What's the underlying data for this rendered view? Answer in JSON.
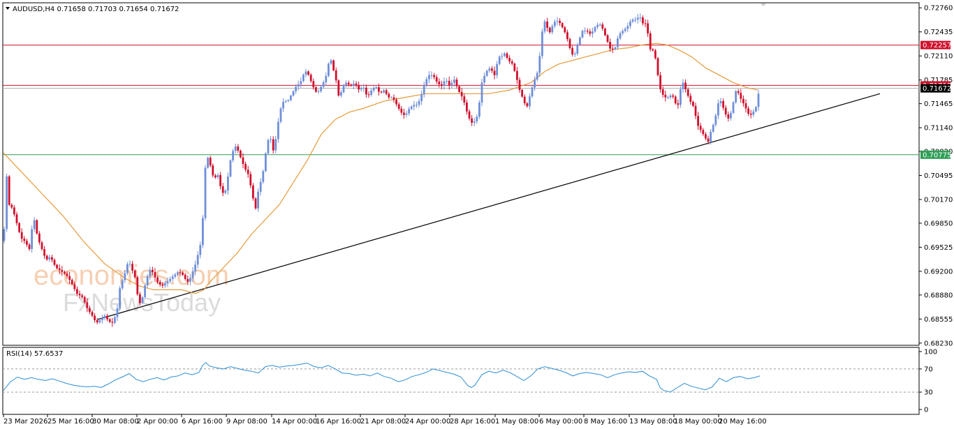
{
  "header": {
    "symbol_line": "AUDUSD,H4  0.71658 0.71703 0.71654 0.71672"
  },
  "rsi_header": "RSI(14) 57.6537",
  "watermark": {
    "line1": "economies.com",
    "line2": "FxNewsToday"
  },
  "colors": {
    "bull": "#6f8fd8",
    "bear": "#d0102c",
    "ma": "#e59a3a",
    "rsi": "#2a8dd4",
    "resistance": "#d0102c",
    "support": "#2e9e57",
    "trend": "#000000",
    "grid": "#808080"
  },
  "levels": [
    {
      "name": "resistance-1",
      "value": 0.72257,
      "label": "0.72257",
      "color": "#d0102c"
    },
    {
      "name": "resistance-2",
      "value": 0.71712,
      "label": "0.71712",
      "color": "#d0102c"
    },
    {
      "name": "current-price",
      "value": 0.71672,
      "label": "0.71672",
      "color": "#000000"
    },
    {
      "name": "support",
      "value": 0.70775,
      "label": "0.70775",
      "color": "#2e9e57"
    }
  ],
  "chart_data": {
    "type": "candlestick",
    "symbol": "AUDUSD",
    "timeframe": "H4",
    "y_ticks": [
      0.7276,
      0.72435,
      0.7211,
      0.71785,
      0.71465,
      0.7114,
      0.7082,
      0.70495,
      0.7017,
      0.6985,
      0.69525,
      0.692,
      0.6888,
      0.68555,
      0.6823
    ],
    "y_tick_labels": [
      "0.72760",
      "0.72435",
      "0.72110",
      "0.71785",
      "0.71465",
      "0.71140",
      "0.70820",
      "0.70495",
      "0.70170",
      "0.69850",
      "0.69525",
      "0.69200",
      "0.68880",
      "0.68555",
      "0.68230"
    ],
    "ylim": [
      0.682,
      0.7295
    ],
    "x_labels": [
      "23 Mar 2026",
      "25 Mar 16:00",
      "30 Mar 08:00",
      "2 Apr 00:00",
      "6 Apr 16:00",
      "9 Apr 08:00",
      "14 Apr 00:00",
      "16 Apr 16:00",
      "21 Apr 08:00",
      "24 Apr 00:00",
      "28 Apr 16:00",
      "1 May 08:00",
      "6 May 00:00",
      "8 May 16:00",
      "13 May 08:00",
      "18 May 00:00",
      "20 May 16:00"
    ],
    "price_path": [
      [
        0,
        0.7015
      ],
      [
        4,
        0.6925
      ],
      [
        9,
        0.7055
      ],
      [
        13,
        0.701
      ],
      [
        18,
        0.7005
      ],
      [
        24,
        0.6985
      ],
      [
        30,
        0.6965
      ],
      [
        36,
        0.696
      ],
      [
        42,
        0.695
      ],
      [
        48,
        0.6995
      ],
      [
        54,
        0.6965
      ],
      [
        60,
        0.695
      ],
      [
        66,
        0.6935
      ],
      [
        72,
        0.694
      ],
      [
        80,
        0.6925
      ],
      [
        88,
        0.692
      ],
      [
        95,
        0.6915
      ],
      [
        102,
        0.6905
      ],
      [
        110,
        0.689
      ],
      [
        118,
        0.6885
      ],
      [
        125,
        0.687
      ],
      [
        132,
        0.686
      ],
      [
        138,
        0.685
      ],
      [
        144,
        0.6855
      ],
      [
        150,
        0.686
      ],
      [
        156,
        0.6852
      ],
      [
        162,
        0.685
      ],
      [
        168,
        0.687
      ],
      [
        172,
        0.69
      ],
      [
        178,
        0.6915
      ],
      [
        184,
        0.6935
      ],
      [
        188,
        0.6925
      ],
      [
        194,
        0.691
      ],
      [
        198,
        0.688
      ],
      [
        202,
        0.6875
      ],
      [
        206,
        0.6895
      ],
      [
        210,
        0.691
      ],
      [
        216,
        0.6925
      ],
      [
        220,
        0.6915
      ],
      [
        226,
        0.6905
      ],
      [
        232,
        0.69
      ],
      [
        238,
        0.6905
      ],
      [
        244,
        0.691
      ],
      [
        250,
        0.6915
      ],
      [
        256,
        0.692
      ],
      [
        262,
        0.6915
      ],
      [
        268,
        0.6905
      ],
      [
        272,
        0.691
      ],
      [
        276,
        0.692
      ],
      [
        280,
        0.693
      ],
      [
        284,
        0.6945
      ],
      [
        288,
        0.696
      ],
      [
        291,
        0.7
      ],
      [
        294,
        0.706
      ],
      [
        298,
        0.7075
      ],
      [
        302,
        0.706
      ],
      [
        306,
        0.7045
      ],
      [
        312,
        0.705
      ],
      [
        318,
        0.7025
      ],
      [
        324,
        0.703
      ],
      [
        328,
        0.706
      ],
      [
        332,
        0.708
      ],
      [
        338,
        0.709
      ],
      [
        344,
        0.7075
      ],
      [
        350,
        0.706
      ],
      [
        356,
        0.705
      ],
      [
        362,
        0.702
      ],
      [
        366,
        0.7005
      ],
      [
        370,
        0.703
      ],
      [
        376,
        0.705
      ],
      [
        382,
        0.709
      ],
      [
        386,
        0.7105
      ],
      [
        392,
        0.708
      ],
      [
        398,
        0.712
      ],
      [
        402,
        0.714
      ],
      [
        406,
        0.715
      ],
      [
        412,
        0.715
      ],
      [
        418,
        0.716
      ],
      [
        424,
        0.717
      ],
      [
        430,
        0.7175
      ],
      [
        434,
        0.7185
      ],
      [
        438,
        0.719
      ],
      [
        442,
        0.7185
      ],
      [
        448,
        0.717
      ],
      [
        454,
        0.716
      ],
      [
        460,
        0.717
      ],
      [
        466,
        0.718
      ],
      [
        470,
        0.72
      ],
      [
        474,
        0.7205
      ],
      [
        478,
        0.719
      ],
      [
        482,
        0.7175
      ],
      [
        486,
        0.715
      ],
      [
        490,
        0.717
      ],
      [
        496,
        0.7175
      ],
      [
        502,
        0.717
      ],
      [
        508,
        0.7175
      ],
      [
        514,
        0.7165
      ],
      [
        520,
        0.717
      ],
      [
        526,
        0.7155
      ],
      [
        532,
        0.7165
      ],
      [
        538,
        0.717
      ],
      [
        544,
        0.716
      ],
      [
        550,
        0.7165
      ],
      [
        556,
        0.7155
      ],
      [
        562,
        0.7155
      ],
      [
        568,
        0.7145
      ],
      [
        574,
        0.7135
      ],
      [
        580,
        0.713
      ],
      [
        586,
        0.714
      ],
      [
        592,
        0.7145
      ],
      [
        598,
        0.7145
      ],
      [
        604,
        0.716
      ],
      [
        608,
        0.7175
      ],
      [
        614,
        0.7185
      ],
      [
        620,
        0.7185
      ],
      [
        626,
        0.7175
      ],
      [
        632,
        0.717
      ],
      [
        638,
        0.718
      ],
      [
        644,
        0.717
      ],
      [
        650,
        0.718
      ],
      [
        656,
        0.7165
      ],
      [
        662,
        0.7155
      ],
      [
        666,
        0.7145
      ],
      [
        670,
        0.713
      ],
      [
        676,
        0.712
      ],
      [
        682,
        0.7125
      ],
      [
        686,
        0.7145
      ],
      [
        690,
        0.7175
      ],
      [
        696,
        0.719
      ],
      [
        702,
        0.7195
      ],
      [
        708,
        0.7185
      ],
      [
        714,
        0.721
      ],
      [
        718,
        0.721
      ],
      [
        722,
        0.7215
      ],
      [
        728,
        0.7205
      ],
      [
        734,
        0.72
      ],
      [
        740,
        0.718
      ],
      [
        744,
        0.7165
      ],
      [
        748,
        0.7155
      ],
      [
        754,
        0.714
      ],
      [
        758,
        0.7155
      ],
      [
        764,
        0.7175
      ],
      [
        770,
        0.719
      ],
      [
        774,
        0.722
      ],
      [
        778,
        0.726
      ],
      [
        782,
        0.7255
      ],
      [
        786,
        0.724
      ],
      [
        790,
        0.725
      ],
      [
        796,
        0.726
      ],
      [
        802,
        0.7255
      ],
      [
        808,
        0.7245
      ],
      [
        812,
        0.7235
      ],
      [
        818,
        0.7215
      ],
      [
        822,
        0.721
      ],
      [
        828,
        0.723
      ],
      [
        834,
        0.7245
      ],
      [
        840,
        0.7245
      ],
      [
        846,
        0.724
      ],
      [
        852,
        0.725
      ],
      [
        858,
        0.7255
      ],
      [
        862,
        0.725
      ],
      [
        868,
        0.7235
      ],
      [
        874,
        0.722
      ],
      [
        880,
        0.722
      ],
      [
        886,
        0.724
      ],
      [
        892,
        0.7245
      ],
      [
        898,
        0.725
      ],
      [
        904,
        0.726
      ],
      [
        910,
        0.726
      ],
      [
        916,
        0.7265
      ],
      [
        920,
        0.7255
      ],
      [
        924,
        0.7255
      ],
      [
        928,
        0.724
      ],
      [
        932,
        0.7215
      ],
      [
        936,
        0.722
      ],
      [
        940,
        0.72
      ],
      [
        944,
        0.717
      ],
      [
        948,
        0.716
      ],
      [
        952,
        0.7155
      ],
      [
        958,
        0.7155
      ],
      [
        962,
        0.716
      ],
      [
        966,
        0.715
      ],
      [
        970,
        0.714
      ],
      [
        974,
        0.7165
      ],
      [
        978,
        0.7175
      ],
      [
        984,
        0.716
      ],
      [
        988,
        0.715
      ],
      [
        992,
        0.7145
      ],
      [
        996,
        0.713
      ],
      [
        1000,
        0.7115
      ],
      [
        1004,
        0.711
      ],
      [
        1010,
        0.71
      ],
      [
        1014,
        0.7095
      ],
      [
        1018,
        0.711
      ],
      [
        1022,
        0.712
      ],
      [
        1026,
        0.7135
      ],
      [
        1030,
        0.7155
      ],
      [
        1036,
        0.714
      ],
      [
        1040,
        0.713
      ],
      [
        1044,
        0.7125
      ],
      [
        1048,
        0.714
      ],
      [
        1054,
        0.7165
      ],
      [
        1058,
        0.716
      ],
      [
        1062,
        0.715
      ],
      [
        1066,
        0.7145
      ],
      [
        1070,
        0.7135
      ],
      [
        1074,
        0.713
      ],
      [
        1078,
        0.7135
      ],
      [
        1082,
        0.714
      ],
      [
        1086,
        0.716
      ],
      [
        1088,
        0.7167
      ]
    ],
    "ma_path": [
      [
        5,
        0.708
      ],
      [
        30,
        0.7055
      ],
      [
        60,
        0.7025
      ],
      [
        90,
        0.6995
      ],
      [
        120,
        0.696
      ],
      [
        150,
        0.693
      ],
      [
        180,
        0.691
      ],
      [
        200,
        0.69
      ],
      [
        220,
        0.6895
      ],
      [
        240,
        0.6895
      ],
      [
        260,
        0.6895
      ],
      [
        280,
        0.689
      ],
      [
        292,
        0.6895
      ],
      [
        300,
        0.6905
      ],
      [
        320,
        0.6925
      ],
      [
        340,
        0.6945
      ],
      [
        360,
        0.697
      ],
      [
        380,
        0.699
      ],
      [
        400,
        0.701
      ],
      [
        420,
        0.704
      ],
      [
        440,
        0.707
      ],
      [
        460,
        0.7105
      ],
      [
        480,
        0.7125
      ],
      [
        500,
        0.7135
      ],
      [
        520,
        0.714
      ],
      [
        550,
        0.715
      ],
      [
        580,
        0.7155
      ],
      [
        610,
        0.716
      ],
      [
        640,
        0.716
      ],
      [
        670,
        0.716
      ],
      [
        700,
        0.716
      ],
      [
        730,
        0.7165
      ],
      [
        760,
        0.7175
      ],
      [
        780,
        0.719
      ],
      [
        800,
        0.72
      ],
      [
        820,
        0.7205
      ],
      [
        840,
        0.721
      ],
      [
        860,
        0.7215
      ],
      [
        880,
        0.722
      ],
      [
        900,
        0.7222
      ],
      [
        920,
        0.7226
      ],
      [
        940,
        0.7228
      ],
      [
        955,
        0.7226
      ],
      [
        970,
        0.722
      ],
      [
        990,
        0.721
      ],
      [
        1010,
        0.7195
      ],
      [
        1030,
        0.7185
      ],
      [
        1050,
        0.7175
      ],
      [
        1070,
        0.7168
      ],
      [
        1085,
        0.7165
      ]
    ],
    "trend_line": [
      [
        140,
        0.6855
      ],
      [
        1260,
        0.716
      ]
    ],
    "rsi": {
      "period": 14,
      "value": 57.6537,
      "levels": [
        70,
        30
      ],
      "y_ticks": [
        100,
        70,
        30,
        0
      ],
      "ylim": [
        0,
        100
      ],
      "path": [
        [
          5,
          33
        ],
        [
          15,
          48
        ],
        [
          25,
          56
        ],
        [
          35,
          52
        ],
        [
          45,
          55
        ],
        [
          55,
          52
        ],
        [
          65,
          50
        ],
        [
          75,
          53
        ],
        [
          85,
          49
        ],
        [
          95,
          45
        ],
        [
          105,
          42
        ],
        [
          115,
          40
        ],
        [
          125,
          39
        ],
        [
          135,
          40
        ],
        [
          145,
          38
        ],
        [
          155,
          44
        ],
        [
          165,
          51
        ],
        [
          175,
          56
        ],
        [
          185,
          62
        ],
        [
          195,
          52
        ],
        [
          205,
          48
        ],
        [
          215,
          52
        ],
        [
          225,
          55
        ],
        [
          235,
          51
        ],
        [
          245,
          56
        ],
        [
          255,
          58
        ],
        [
          265,
          63
        ],
        [
          275,
          60
        ],
        [
          285,
          64
        ],
        [
          290,
          76
        ],
        [
          295,
          81
        ],
        [
          300,
          75
        ],
        [
          310,
          72
        ],
        [
          320,
          70
        ],
        [
          330,
          74
        ],
        [
          340,
          71
        ],
        [
          350,
          68
        ],
        [
          360,
          66
        ],
        [
          370,
          63
        ],
        [
          380,
          74
        ],
        [
          390,
          76
        ],
        [
          400,
          73
        ],
        [
          410,
          75
        ],
        [
          420,
          76
        ],
        [
          430,
          78
        ],
        [
          440,
          80
        ],
        [
          450,
          74
        ],
        [
          460,
          72
        ],
        [
          470,
          76
        ],
        [
          480,
          70
        ],
        [
          490,
          63
        ],
        [
          500,
          62
        ],
        [
          510,
          59
        ],
        [
          520,
          61
        ],
        [
          530,
          58
        ],
        [
          540,
          63
        ],
        [
          550,
          57
        ],
        [
          560,
          54
        ],
        [
          570,
          48
        ],
        [
          580,
          51
        ],
        [
          590,
          57
        ],
        [
          600,
          60
        ],
        [
          610,
          64
        ],
        [
          620,
          70
        ],
        [
          630,
          67
        ],
        [
          640,
          64
        ],
        [
          650,
          61
        ],
        [
          660,
          56
        ],
        [
          670,
          41
        ],
        [
          675,
          38
        ],
        [
          680,
          42
        ],
        [
          690,
          60
        ],
        [
          700,
          66
        ],
        [
          710,
          63
        ],
        [
          720,
          68
        ],
        [
          730,
          64
        ],
        [
          740,
          57
        ],
        [
          750,
          50
        ],
        [
          760,
          58
        ],
        [
          770,
          70
        ],
        [
          780,
          74
        ],
        [
          790,
          71
        ],
        [
          800,
          68
        ],
        [
          810,
          64
        ],
        [
          820,
          58
        ],
        [
          830,
          62
        ],
        [
          840,
          64
        ],
        [
          850,
          62
        ],
        [
          860,
          60
        ],
        [
          870,
          55
        ],
        [
          880,
          60
        ],
        [
          890,
          63
        ],
        [
          900,
          65
        ],
        [
          910,
          64
        ],
        [
          920,
          66
        ],
        [
          930,
          58
        ],
        [
          940,
          52
        ],
        [
          945,
          38
        ],
        [
          950,
          33
        ],
        [
          960,
          30
        ],
        [
          970,
          38
        ],
        [
          980,
          45
        ],
        [
          990,
          40
        ],
        [
          1000,
          37
        ],
        [
          1010,
          34
        ],
        [
          1020,
          39
        ],
        [
          1030,
          54
        ],
        [
          1040,
          48
        ],
        [
          1050,
          55
        ],
        [
          1060,
          57
        ],
        [
          1070,
          53
        ],
        [
          1080,
          55
        ],
        [
          1088,
          58
        ]
      ]
    }
  }
}
